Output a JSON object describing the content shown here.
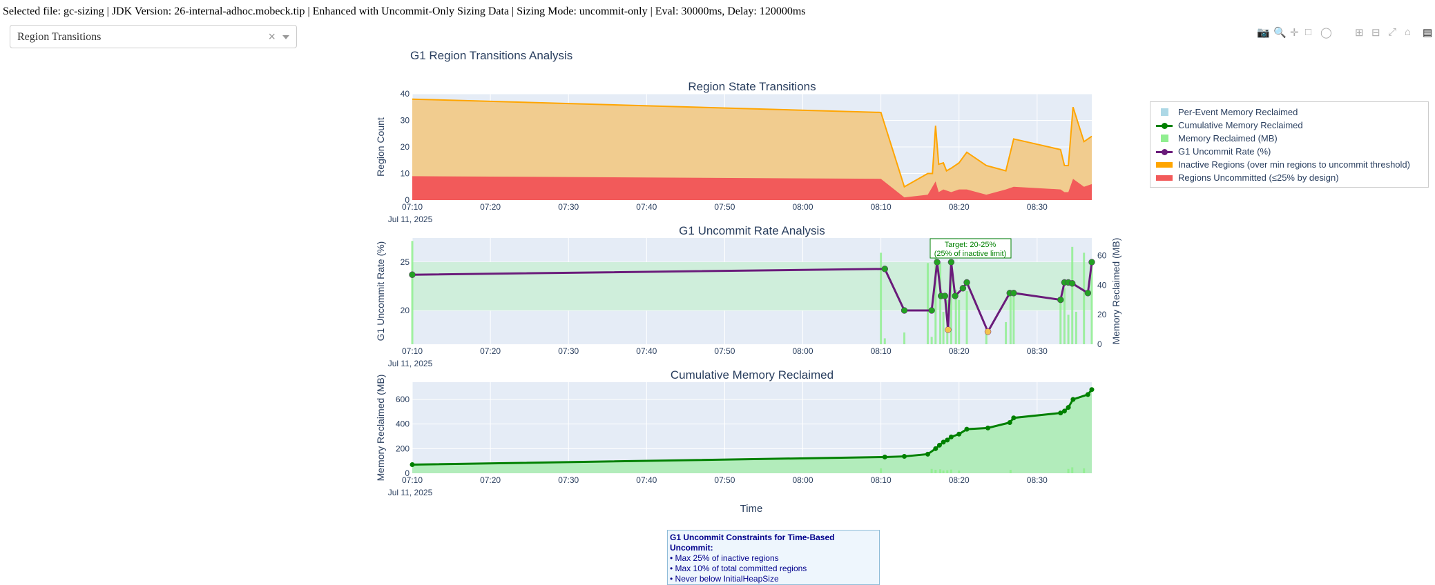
{
  "header": {
    "info": "Selected file: gc-sizing | JDK Version: 26-internal-adhoc.mobeck.tip | Enhanced with Uncommit-Only Sizing Data | Sizing Mode: uncommit-only | Eval: 30000ms, Delay: 120000ms"
  },
  "dropdown": {
    "selected": "Region Transitions",
    "clear_glyph": "×"
  },
  "modebar": {
    "icons": [
      "camera-icon",
      "zoom-icon",
      "pan-icon",
      "box-select-icon",
      "lasso-icon",
      "zoom-in-icon",
      "zoom-out-icon",
      "autoscale-icon",
      "reset-icon",
      "plotly-logo-icon"
    ]
  },
  "figure_title": "G1 Region Transitions Analysis",
  "legend": [
    {
      "label": "Per-Event Memory Reclaimed",
      "color": "#add8e6",
      "kind": "square"
    },
    {
      "label": "Cumulative Memory Reclaimed",
      "color": "#008000",
      "kind": "line-dot"
    },
    {
      "label": "Memory Reclaimed (MB)",
      "color": "#90ee90",
      "kind": "square"
    },
    {
      "label": "G1 Uncommit Rate (%)",
      "color": "#6a1b7a",
      "kind": "line-dot"
    },
    {
      "label": "Inactive Regions (over min regions to uncommit threshold)",
      "color": "#ffa500",
      "kind": "band"
    },
    {
      "label": "Regions Uncommitted (≤25% by design)",
      "color": "#f25a5a",
      "kind": "band"
    }
  ],
  "time_ticks": [
    "07:10",
    "07:20",
    "07:30",
    "07:40",
    "07:50",
    "08:00",
    "08:10",
    "08:20",
    "08:30"
  ],
  "date_label": "Jul 11, 2025",
  "xaxis_title": "Time",
  "annotation": {
    "line1": "Target: 20-25%",
    "line2": "(25% of inactive limit)"
  },
  "constraints": {
    "title": "G1 Uncommit Constraints for Time-Based Uncommit:",
    "items": [
      "• Max 25% of inactive regions",
      "• Max 10% of total committed regions",
      "• Never below InitialHeapSize"
    ]
  },
  "colors": {
    "plot_bg": "#e5ecf6",
    "inactive_line": "#ffa500",
    "inactive_fill": "#f1cc8f",
    "uncommitted_fill": "#f25a5a",
    "rate_line": "#6a1b7a",
    "rate_marker": "#23a123",
    "target_band": "#cfeedb",
    "bars": "#90ee90",
    "cumulative": "#008000",
    "cumulative_fill": "#b2ecbb"
  },
  "chart_data": [
    {
      "type": "area",
      "title": "Region State Transitions",
      "xlabel": "",
      "ylabel": "Region Count",
      "x_range": [
        "07:10",
        "08:37"
      ],
      "ylim": [
        0,
        40
      ],
      "yticks": [
        0,
        10,
        20,
        30,
        40
      ],
      "series": [
        {
          "name": "Inactive Regions (over min regions to uncommit threshold)",
          "x": [
            "07:10",
            "08:10",
            "08:13",
            "08:16",
            "08:16.6",
            "08:17",
            "08:17.4",
            "08:18",
            "08:18.4",
            "08:19",
            "08:20",
            "08:21",
            "08:23.5",
            "08:26",
            "08:27",
            "08:33",
            "08:33.5",
            "08:34",
            "08:34.6",
            "08:36",
            "08:37"
          ],
          "y": [
            38,
            33,
            5,
            10,
            10,
            28,
            13.5,
            14,
            11,
            12,
            14,
            18,
            13,
            11,
            23,
            19,
            13,
            13,
            35,
            22,
            24
          ]
        },
        {
          "name": "Regions Uncommitted (≤25% by design)",
          "x": [
            "07:10",
            "08:10",
            "08:13",
            "08:16",
            "08:17",
            "08:17.4",
            "08:18",
            "08:19",
            "08:20",
            "08:21",
            "08:23.5",
            "08:26",
            "08:27",
            "08:33",
            "08:33.5",
            "08:34",
            "08:34.6",
            "08:36",
            "08:37"
          ],
          "y": [
            9,
            8,
            1,
            2,
            7,
            3,
            4,
            3,
            4,
            4,
            2,
            4,
            5,
            4,
            3,
            3,
            8,
            5,
            6
          ]
        }
      ]
    },
    {
      "type": "line",
      "title": "G1 Uncommit Rate Analysis",
      "xlabel": "",
      "ylabel": "G1 Uncommit Rate (%)",
      "y2label": "Memory Reclaimed (MB)",
      "x_range": [
        "07:10",
        "08:37"
      ],
      "ylim": [
        16.5,
        27.5
      ],
      "yticks": [
        20,
        25
      ],
      "y2lim": [
        0,
        72
      ],
      "y2ticks": [
        0,
        20,
        40,
        60
      ],
      "target_band": [
        20,
        25
      ],
      "series": [
        {
          "name": "G1 Uncommit Rate (%)",
          "x": [
            "07:10",
            "08:10.5",
            "08:13",
            "08:16.5",
            "08:17.2",
            "08:17.7",
            "08:18.2",
            "08:18.6",
            "08:19",
            "08:19.5",
            "08:20.5",
            "08:21",
            "08:23.7",
            "08:26.5",
            "08:27",
            "08:33",
            "08:33.5",
            "08:34",
            "08:34.5",
            "08:36.5",
            "08:37"
          ],
          "y": [
            23.7,
            24.3,
            20,
            20,
            25,
            21.5,
            21.5,
            18,
            25,
            21.5,
            22.3,
            22.9,
            17.8,
            21.8,
            21.8,
            21.1,
            22.9,
            22.9,
            22.8,
            21.8,
            25
          ]
        },
        {
          "name": "Memory Reclaimed (MB)",
          "axis": "y2",
          "x": [
            "07:10",
            "08:10",
            "08:10.5",
            "08:13",
            "08:16",
            "08:16.5",
            "08:17",
            "08:17.6",
            "08:18",
            "08:18.5",
            "08:19",
            "08:19.6",
            "08:20",
            "08:21",
            "08:23.5",
            "08:26",
            "08:26.6",
            "08:27",
            "08:33",
            "08:33.5",
            "08:34",
            "08:34.5",
            "08:35",
            "08:36",
            "08:37"
          ],
          "y": [
            70,
            62,
            4,
            8,
            55,
            5,
            62,
            55,
            22,
            30,
            47,
            37,
            30,
            36,
            8,
            15,
            34,
            34,
            28,
            38,
            20,
            66,
            22,
            62,
            54
          ]
        }
      ]
    },
    {
      "type": "area",
      "title": "Cumulative Memory Reclaimed",
      "xlabel": "Time",
      "ylabel": "Memory Reclaimed (MB)",
      "x_range": [
        "07:10",
        "08:37"
      ],
      "ylim": [
        0,
        740
      ],
      "yticks": [
        0,
        200,
        400,
        600
      ],
      "series": [
        {
          "name": "Cumulative Memory Reclaimed",
          "x": [
            "07:10",
            "08:10.5",
            "08:13",
            "08:16",
            "08:17",
            "08:17.5",
            "08:18",
            "08:18.5",
            "08:19",
            "08:20",
            "08:21",
            "08:23.7",
            "08:26.5",
            "08:27",
            "08:33",
            "08:33.5",
            "08:34",
            "08:34.6",
            "08:36.5",
            "08:37"
          ],
          "y": [
            70,
            132,
            137,
            155,
            200,
            228,
            253,
            270,
            295,
            318,
            358,
            368,
            412,
            450,
            490,
            505,
            535,
            600,
            640,
            680
          ]
        },
        {
          "name": "Per-Event Memory Reclaimed",
          "x": [
            "08:10",
            "08:16.5",
            "08:17",
            "08:17.6",
            "08:18",
            "08:18.5",
            "08:19",
            "08:20",
            "08:26.6",
            "08:34",
            "08:34.5",
            "08:36"
          ],
          "y": [
            40,
            35,
            28,
            32,
            22,
            25,
            30,
            22,
            28,
            35,
            48,
            40
          ]
        }
      ]
    }
  ]
}
